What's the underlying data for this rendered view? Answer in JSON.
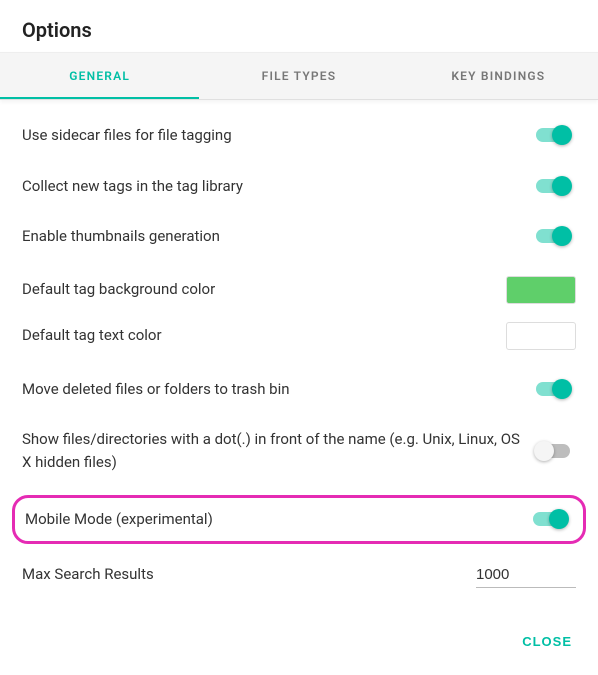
{
  "title": "Options",
  "tabs": {
    "general": "GENERAL",
    "fileTypes": "FILE TYPES",
    "keyBindings": "KEY BINDINGS"
  },
  "settings": {
    "sidecar": {
      "label": "Use sidecar files for file tagging",
      "on": true
    },
    "collectTags": {
      "label": "Collect new tags in the tag library",
      "on": true
    },
    "thumbnails": {
      "label": "Enable thumbnails generation",
      "on": true
    },
    "bgColor": {
      "label": "Default tag background color",
      "value": "#5fcf6a"
    },
    "textColor": {
      "label": "Default tag text color",
      "value": "#ffffff"
    },
    "trash": {
      "label": "Move deleted files or folders to trash bin",
      "on": true
    },
    "hiddenFiles": {
      "label": "Show files/directories with a dot(.) in front of the name (e.g. Unix, Linux, OS X hidden files)",
      "on": false
    },
    "mobileMode": {
      "label": "Mobile Mode (experimental)",
      "on": true
    },
    "maxSearch": {
      "label": "Max Search Results",
      "value": "1000"
    }
  },
  "footer": {
    "close": "CLOSE"
  }
}
